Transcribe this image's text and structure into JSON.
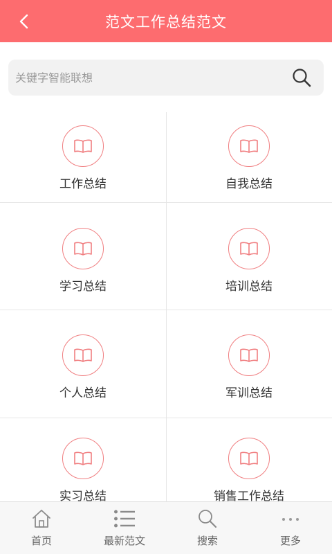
{
  "header": {
    "title": "范文工作总结范文",
    "back_icon": "chevron-left-icon"
  },
  "search": {
    "placeholder": "关键字智能联想",
    "icon": "search-icon"
  },
  "grid": {
    "items": [
      {
        "label": "工作总结",
        "icon": "book-icon"
      },
      {
        "label": "自我总结",
        "icon": "book-icon"
      },
      {
        "label": "学习总结",
        "icon": "book-icon"
      },
      {
        "label": "培训总结",
        "icon": "book-icon"
      },
      {
        "label": "个人总结",
        "icon": "book-icon"
      },
      {
        "label": "军训总结",
        "icon": "book-icon"
      },
      {
        "label": "实习总结",
        "icon": "book-icon"
      },
      {
        "label": "销售工作总结",
        "icon": "book-icon"
      }
    ]
  },
  "tabbar": {
    "items": [
      {
        "label": "首页",
        "icon": "home-icon"
      },
      {
        "label": "最新范文",
        "icon": "list-icon"
      },
      {
        "label": "搜索",
        "icon": "search-icon"
      },
      {
        "label": "更多",
        "icon": "more-icon"
      }
    ]
  },
  "colors": {
    "header_bg": "#fd6c6f",
    "accent": "#f07e80",
    "tab_text": "#666666"
  }
}
